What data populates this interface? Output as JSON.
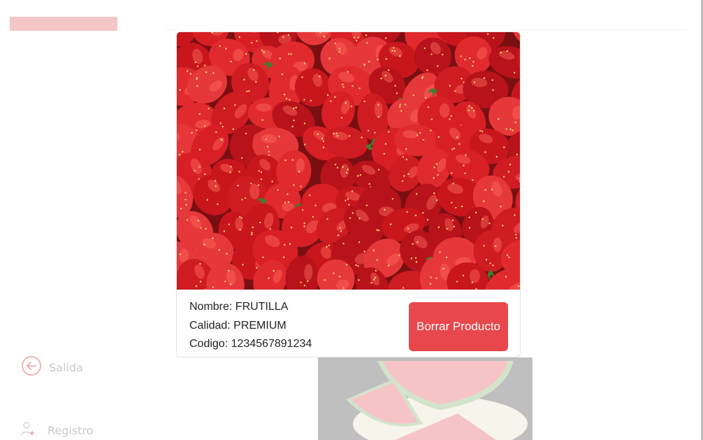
{
  "sidebar": {
    "items": [
      {
        "label": "Salida",
        "icon": "arrow-left-circle-icon"
      },
      {
        "label": "Registro",
        "icon": "user-plus-icon"
      }
    ]
  },
  "product": {
    "image_subject": "strawberries",
    "name_label": "Nombre: FRUTILLA",
    "quality_label": "Calidad: PREMIUM",
    "code_label": "Codigo: 1234567891234",
    "delete_label": "Borrar Producto"
  },
  "background_product": {
    "image_subject": "watermelon slices"
  },
  "colors": {
    "accent": "#e8474c",
    "sidebar_faded": "#f4c6c8",
    "strawberry": "#d81f26"
  }
}
